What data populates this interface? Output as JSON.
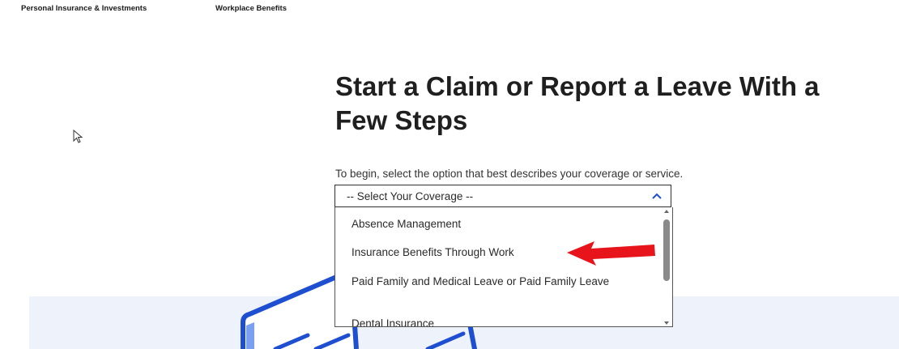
{
  "topnav": {
    "items": [
      {
        "label": "Personal Insurance & Investments"
      },
      {
        "label": "Workplace Benefits"
      }
    ]
  },
  "hero": {
    "title": "Start a Claim or Report a Leave With a Few Steps",
    "intro": "To begin, select the option that best describes your coverage or service."
  },
  "coverage_select": {
    "selected": "-- Select Your Coverage --",
    "options": [
      {
        "label": "Absence Management"
      },
      {
        "label": "Insurance Benefits Through Work"
      },
      {
        "label": "Paid Family and Medical Leave or Paid Family Leave"
      },
      {
        "label": "Dental Insurance"
      }
    ]
  },
  "colors": {
    "annotation_arrow": "#e8141b",
    "band": "#eef2fb",
    "illustration_blue": "#1f4fd1"
  },
  "icons": {
    "cursor": "mouse-pointer-icon",
    "chevron": "chevron-up-icon",
    "annotation": "red-arrow-icon"
  }
}
